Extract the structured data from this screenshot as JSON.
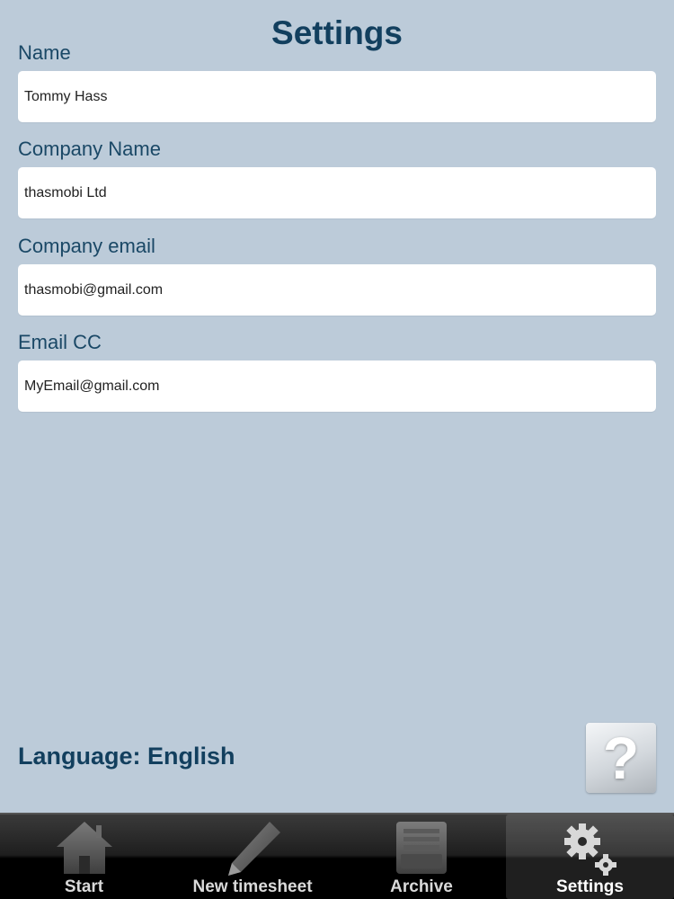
{
  "header": {
    "title": "Settings"
  },
  "form": {
    "fields": [
      {
        "label": "Name",
        "value": "Tommy Hass"
      },
      {
        "label": "Company Name",
        "value": "thasmobi Ltd"
      },
      {
        "label": "Company email",
        "value": "thasmobi@gmail.com"
      },
      {
        "label": "Email CC",
        "value": "MyEmail@gmail.com"
      }
    ]
  },
  "language": {
    "label": "Language: English"
  },
  "help": {
    "icon": "question-mark-icon",
    "glyph": "?"
  },
  "tabbar": {
    "active": "Settings",
    "tabs": [
      {
        "label": "Start",
        "icon": "home-icon"
      },
      {
        "label": "New timesheet",
        "icon": "pencil-icon"
      },
      {
        "label": "Archive",
        "icon": "archive-tray-icon"
      },
      {
        "label": "Settings",
        "icon": "gears-icon"
      }
    ]
  },
  "colors": {
    "background": "#bccbd9",
    "title": "#123f5e",
    "label": "#1a4866",
    "tabbar": "#000000"
  }
}
